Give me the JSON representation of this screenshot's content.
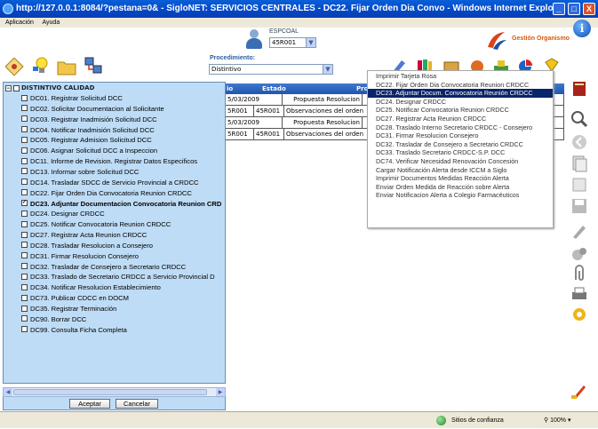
{
  "window": {
    "title": "http://127.0.0.1:8084/?pestana=0& - SigloNET: SERVICIOS CENTRALES - DC22. Fijar Orden Dia Convo - Windows Internet Explorer",
    "min": "_",
    "max": "□",
    "close": "X"
  },
  "menu": [
    "Aplicación",
    "Ayuda"
  ],
  "header": {
    "user_label": "ESPCOAL",
    "user_value": "45R001",
    "org_label": "Gestión Organismo",
    "info": "i"
  },
  "procedimiento": {
    "label": "Procedimiento:",
    "value": "Distintivo"
  },
  "grid": {
    "columns": [
      "io",
      "Estado",
      "Pro"
    ],
    "rows": [
      [
        "5/03/2009",
        "",
        "Propuesta Resolucion"
      ],
      [
        "5R001",
        "45R001",
        "Observaciones del orden"
      ],
      [
        "5/03/2009",
        "",
        "Propuesta Resolucion"
      ],
      [
        "5R001",
        "45R001",
        "Observaciones del orden"
      ]
    ]
  },
  "tree": {
    "root_label": "DISTINTIVO CALIDAD",
    "collapse": "−",
    "items": [
      {
        "label": "DC01. Registrar Solicitud DCC",
        "checked": false
      },
      {
        "label": "DC02. Solicitar Documentacion al Solicitante",
        "checked": false
      },
      {
        "label": "DC03. Registrar Inadmisión Solicitud DCC",
        "checked": false
      },
      {
        "label": "DC04. Notificar Inadmisión Solicitud DCC",
        "checked": false
      },
      {
        "label": "DC05. Registrar Admision Solicitud DCC",
        "checked": false
      },
      {
        "label": "DC06. Asignar Solicitud DCC a Inspeccion",
        "checked": false
      },
      {
        "label": "DC11. Informe de Revision. Registrar Datos Especificos",
        "checked": false
      },
      {
        "label": "DC13. Informar sobre Solicitud DCC",
        "checked": false
      },
      {
        "label": "DC14. Trasladar SDCC de Servicio Provincial a CRDCC",
        "checked": false
      },
      {
        "label": "DC22. Fijar Orden Dia Convocatoria Reunion CRDCC",
        "checked": false
      },
      {
        "label": "DC23. Adjuntar Documentacion Convocatoria Reunion CRD",
        "checked": true
      },
      {
        "label": "DC24. Designar CRDCC",
        "checked": false
      },
      {
        "label": "DC25. Notificar Convocatoria Reunion CRDCC",
        "checked": false
      },
      {
        "label": "DC27. Registrar Acta Reunion CRDCC",
        "checked": false
      },
      {
        "label": "DC28. Trasladar Resolucion a Consejero",
        "checked": false
      },
      {
        "label": "DC31. Firmar Resolucion Consejero",
        "checked": false
      },
      {
        "label": "DC32. Trasladar de Consejero a Secretario CRDCC",
        "checked": false
      },
      {
        "label": "DC33. Traslado de Secretario CRDCC a Servicio Provincial D",
        "checked": false
      },
      {
        "label": "DC34. Notificar Resolucion Establecimiento",
        "checked": false
      },
      {
        "label": "DC73. Publicar CDCC en DOCM",
        "checked": false
      },
      {
        "label": "DC35. Registrar Terminación",
        "checked": false
      },
      {
        "label": "DC90. Borrar DCC",
        "checked": false
      },
      {
        "label": "DC99. Consulta Ficha Completa",
        "checked": false
      }
    ],
    "check_mark": "✓"
  },
  "buttons": {
    "accept": "Aceptar",
    "cancel": "Cancelar"
  },
  "dropdown": {
    "items": [
      "Imprimir Tarjeta Rosa",
      "DC22. Fijar Orden Dia Convocatoria Reunion CRDCC",
      "DC23. Adjuntar Docum. Convocatoria Reunión CRDCC",
      "DC24. Designar CRDCC",
      "DC25. Notificar Convocatoria Reunion CRDCC",
      "DC27. Registrar Acta Reunion CRDCC",
      "DC28. Traslado Interno Secretario CRDCC - Consejero",
      "DC31. Firmar Resolucion Consejero",
      "DC32. Trasladar de Consejero a Secretario CRDCC",
      "DC33. Traslado Secretario CRDCC-S.P. DCC",
      "DC74. Verificar Necesidad Renovación Concesión",
      "Cargar Notificación Alerta desde ICCM a Siglo",
      "Imprimir Documentos Medidas Reacción Alerta",
      "Enviar Orden Medida de Reacción sobre Alerta",
      "Enviar Notificacion Alerta a Colegio Farmacéuticos"
    ],
    "selected_index": 2
  },
  "status": {
    "zone": "Sitios de confianza",
    "zoom": "100%"
  },
  "colors": {
    "tree_bg": "#bedcf5",
    "title_bar": "#0347c6",
    "selection": "#0a246a"
  }
}
